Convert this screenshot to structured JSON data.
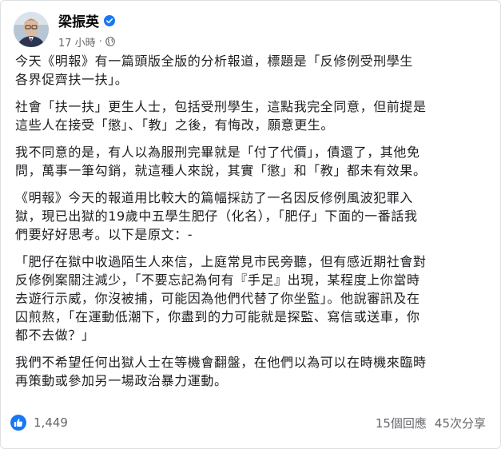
{
  "post": {
    "author": "梁振英",
    "time": "17 小時",
    "dot": "·",
    "paragraphs": [
      "今天《明報》有一篇頭版全版的分析報道，標題是「反修例受刑學生\n各界促齊扶一扶」。",
      "社會「扶一扶」更生人士，包括受刑學生，這點我完全同意，但前提是\n這些人在接受「懲」、「教」之後，有悔改，願意更生。",
      "我不同意的是，有人以為服刑完畢就是「付了代價」，債還了，其他免\n問，萬事一筆勾銷，就這種人來說，其實「懲」和「教」都未有效果。",
      "《明報》今天的報道用比較大的篇幅採訪了一名因反修例風波犯罪入\n獄，現已出獄的19歲中五學生肥仔（化名），「肥仔」下面的一番話我\n們要好好思考。以下是原文：-",
      "「肥仔在獄中收過陌生人來信，上庭常見市民旁聽，但有感近期社會對\n反修例案關注減少，「不要忘記為何有『手足』出現，某程度上你當時\n去遊行示威，你沒被捕，可能因為他們代替了你坐監」。他說審訊及在\n囚煎熬，「在運動低潮下，你盡到的力可能就是探監、寫信或送車，你\n都不去做？」",
      "我們不希望任何出獄人士在等機會翻盤，在他們以為可以在時機來臨時\n再策動或參加另一場政治暴力運動。"
    ]
  },
  "reactions": {
    "like_count": "1,449",
    "comments": "15個回應",
    "shares": "45次分享"
  },
  "colors": {
    "accent": "#1877f2",
    "secondary_text": "#65676b",
    "primary_text": "#1c1e21"
  },
  "icons": {
    "verified": "verified-badge-icon",
    "audience": "globe-icon",
    "like": "thumbs-up-icon"
  }
}
